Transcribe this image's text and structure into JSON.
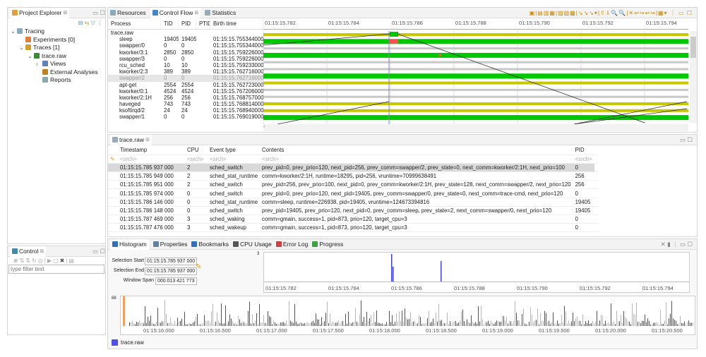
{
  "project_explorer": {
    "title": "Project Explorer",
    "tree": [
      {
        "label": "Tracing",
        "level": 0,
        "icon": "tracing-folder-icon"
      },
      {
        "label": "Experiments [0]",
        "level": 1,
        "icon": "experiments-icon"
      },
      {
        "label": "Traces [1]",
        "level": 1,
        "icon": "traces-icon"
      },
      {
        "label": "trace.raw",
        "level": 2,
        "icon": "trace-icon"
      },
      {
        "label": "Views",
        "level": 3,
        "icon": "views-icon"
      },
      {
        "label": "External Analyses",
        "level": 3,
        "icon": "analyses-icon"
      },
      {
        "label": "Reports",
        "level": 3,
        "icon": "reports-icon"
      }
    ]
  },
  "control": {
    "title": "Control",
    "filter_placeholder": "type filter text"
  },
  "top_tabs": [
    "Resources",
    "Control Flow",
    "Statistics"
  ],
  "control_flow": {
    "columns": [
      "Process",
      "TID",
      "PID",
      "PTID",
      "Birth time"
    ],
    "root": "trace.raw",
    "rows": [
      {
        "process": "sleep",
        "tid": "19405",
        "pid": "19405",
        "birth": "01:15:15.755344000",
        "state": "yellow"
      },
      {
        "process": "swapper/0",
        "tid": "0",
        "pid": "0",
        "birth": "01:15:15.755344000",
        "state": "green"
      },
      {
        "process": "kworker/3:1",
        "tid": "2850",
        "pid": "2850",
        "birth": "01:15:15.759226000",
        "state": "gray"
      },
      {
        "process": "swapper/3",
        "tid": "0",
        "pid": "0",
        "birth": "01:15:15.759226000",
        "state": "green"
      },
      {
        "process": "rcu_sched",
        "tid": "10",
        "pid": "10",
        "birth": "01:15:15.759233000",
        "state": "gray"
      },
      {
        "process": "kworker/2:3",
        "tid": "389",
        "pid": "389",
        "birth": "01:15:15.762716000",
        "state": "gray"
      },
      {
        "process": "swapper/2",
        "tid": "0",
        "pid": "0",
        "birth": "01:15:15.762716000",
        "state": "green",
        "selected": true
      },
      {
        "process": "apt-get",
        "tid": "2554",
        "pid": "2554",
        "birth": "01:15:15.762723000",
        "state": "yellow"
      },
      {
        "process": "kworker/0:1",
        "tid": "4524",
        "pid": "4524",
        "birth": "01:15:15.767206000",
        "state": "gray"
      },
      {
        "process": "kworker/2:1H",
        "tid": "256",
        "pid": "256",
        "birth": "01:15:15.768757000",
        "state": "gray"
      },
      {
        "process": "haveged",
        "tid": "743",
        "pid": "743",
        "birth": "01:15:15.768814000",
        "state": "yellow"
      },
      {
        "process": "ksoftirqd/2",
        "tid": "24",
        "pid": "24",
        "birth": "01:15:15.768940000",
        "state": "yellow"
      },
      {
        "process": "swapper/1",
        "tid": "0",
        "pid": "0",
        "birth": "01:15:15.769019000",
        "state": "green"
      }
    ],
    "time_ticks": [
      "01:15:15.782",
      "01:15:15.784",
      "01:15:15.786",
      "01:15:15.788",
      "01:15:15.790",
      "01:15:15.792",
      "01:15:15.794"
    ]
  },
  "colors": {
    "running": "#00c800",
    "yellow": "#c8c800",
    "gray": "#c8c8c8",
    "red": "#ff5050",
    "hist": "#4040e0",
    "hist_light": "#b0b0f0",
    "selection": "#f0a060"
  },
  "events": {
    "tab": "trace.raw",
    "columns": [
      "Timestamp",
      "CPU",
      "Event type",
      "Contents",
      "PID"
    ],
    "search": "<srch>",
    "rows": [
      [
        "01:15:15.785 937 000",
        "2",
        "sched_switch",
        "prev_pid=0, prev_prio=120, next_pid=256, prev_comm=swapper/2, prev_state=0, next_comm=kworker/2:1H, next_prio=100",
        "0"
      ],
      [
        "01:15:15.785 949 000",
        "2",
        "sched_stat_runtime",
        "comm=kworker/2:1H, runtime=18295, pid=256, vruntime=70999638491",
        "256"
      ],
      [
        "01:15:15.785 951 000",
        "2",
        "sched_switch",
        "prev_pid=256, prev_prio=100, next_pid=0, prev_comm=kworker/2:1H, prev_state=128, next_comm=swapper/2, next_prio=120",
        "256"
      ],
      [
        "01:15:15.785 974 000",
        "0",
        "sched_switch",
        "prev_pid=0, prev_prio=120, next_pid=19405, prev_comm=swapper/0, prev_state=0, next_comm=trace-cmd, next_prio=120",
        "0"
      ],
      [
        "01:15:15.786 146 000",
        "0",
        "sched_stat_runtime",
        "comm=sleep, runtime=226938, pid=19405, vruntime=124673394816",
        "19405"
      ],
      [
        "01:15:15.786 148 000",
        "0",
        "sched_switch",
        "prev_pid=19405, prev_prio=120, next_pid=0, prev_comm=sleep, prev_state=2, next_comm=swapper/0, next_prio=120",
        "19405"
      ],
      [
        "01:15:15.787 469 000",
        "3",
        "sched_waking",
        "comm=gmain, success=1, pid=873, prio=120, target_cpu=3",
        "0"
      ],
      [
        "01:15:15.787 476 000",
        "3",
        "sched_wakeup",
        "comm=gmain, success=1, pid=873, prio=120, target_cpu=3",
        "0"
      ]
    ]
  },
  "bottom_tabs": [
    "Histogram",
    "Properties",
    "Bookmarks",
    "CPU Usage",
    "Error Log",
    "Progress"
  ],
  "histogram": {
    "selection_start_label": "Selection Start",
    "selection_start": "01:15:15.785 937 000",
    "selection_end_label": "Selection End",
    "selection_end": "01:15:15.785 937 000",
    "window_span_label": "Window Span",
    "window_span": "000.013 421 773",
    "zoom_max": "3",
    "zoom_ticks": [
      "01:15:15.782",
      "01:15:15.784",
      "01:15:15.786",
      "01:15:15.788",
      "01:15:15.790",
      "01:15:15.792",
      "01:15:15.794"
    ],
    "full_max": "88",
    "full_ticks": [
      "01:15:16.000",
      "01:15:16.500",
      "01:15:17.000",
      "01:15:17.500",
      "01:15:18.000",
      "01:15:18.500",
      "01:15:19.000",
      "01:15:19.500",
      "01:15:20.000",
      "01:15:20.500"
    ],
    "legend": "trace.raw"
  }
}
